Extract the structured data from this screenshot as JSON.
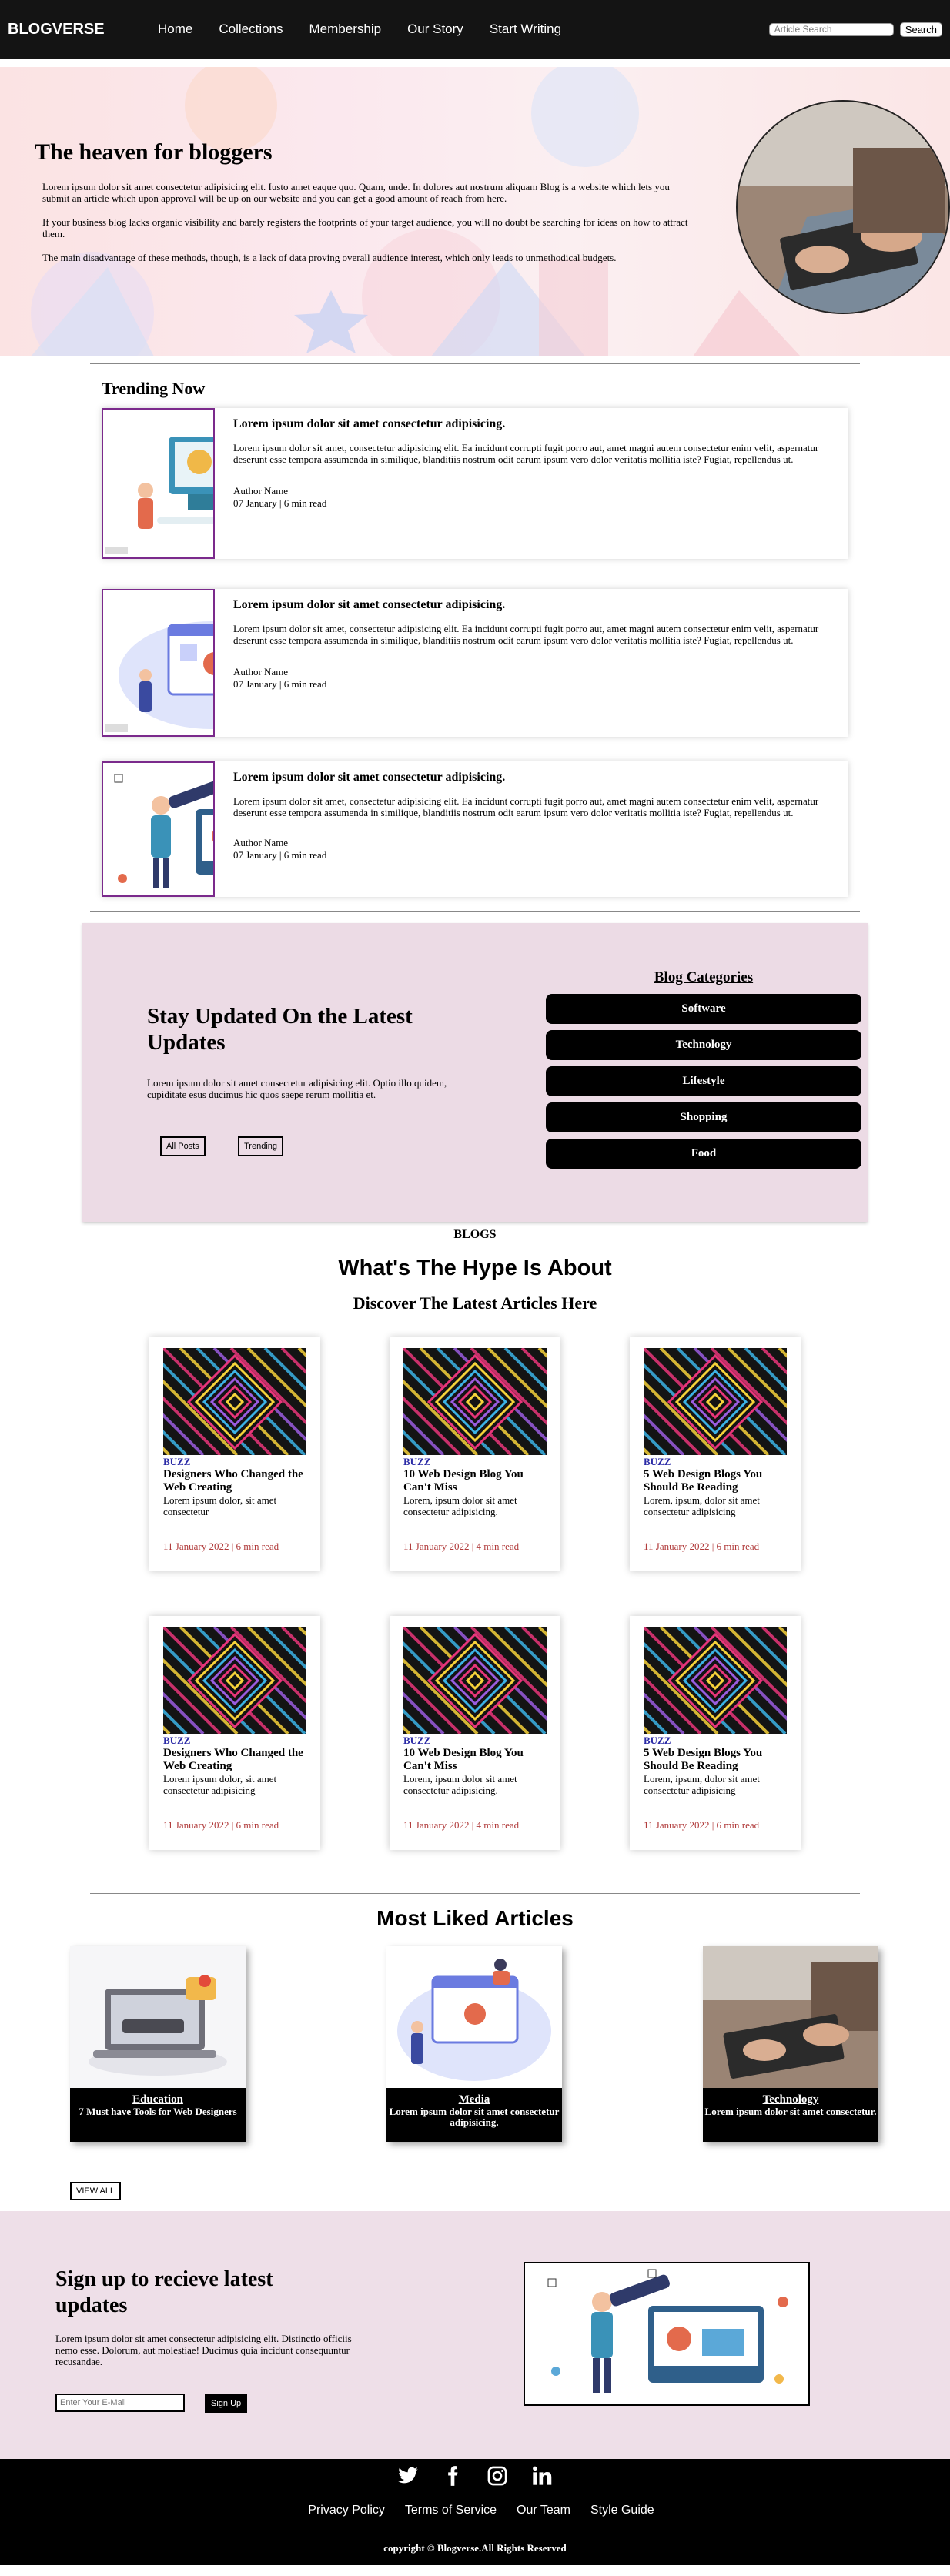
{
  "nav": {
    "brand": "BLOGVERSE",
    "links": [
      "Home",
      "Collections",
      "Membership",
      "Our Story",
      "Start Writing"
    ],
    "search_placeholder": "Article Search",
    "search_button": "Search"
  },
  "hero": {
    "title": "The heaven for bloggers",
    "paragraphs": [
      "Lorem ipsum dolor sit amet consectetur adipisicing elit. Iusto amet eaque quo. Quam, unde. In dolores aut nostrum aliquam Blog is a website which lets you submit an article which upon approval will be up on our website and you can get a good amount of reach from here.",
      "If your business blog lacks organic visibility and barely registers the footprints of your target audience, you will no doubt be searching for ideas on how to attract them.",
      "The main disadvantage of these methods, though, is a lack of data proving overall audience interest, which only leads to unmethodical budgets."
    ]
  },
  "trending": {
    "title": "Trending Now",
    "cards": [
      {
        "title": "Lorem ipsum dolor sit amet consectetur adipisicing.",
        "body": "Lorem ipsum dolor sit amet, consectetur adipisicing elit. Ea incidunt corrupti fugit porro aut, amet magni autem consectetur enim velit, aspernatur deserunt esse tempora assumenda in similique, blanditiis nostrum odit earum ipsum vero dolor veritatis mollitia iste? Fugiat, repellendus ut.",
        "author": "Author Name",
        "meta": "07 January | 6 min read"
      },
      {
        "title": "Lorem ipsum dolor sit amet consectetur adipisicing.",
        "body": "Lorem ipsum dolor sit amet, consectetur adipisicing elit. Ea incidunt corrupti fugit porro aut, amet magni autem consectetur enim velit, aspernatur deserunt esse tempora assumenda in similique, blanditiis nostrum odit earum ipsum vero dolor veritatis mollitia iste? Fugiat, repellendus ut.",
        "author": "Author Name",
        "meta": "07 January | 6 min read"
      },
      {
        "title": "Lorem ipsum dolor sit amet consectetur adipisicing.",
        "body": "Lorem ipsum dolor sit amet, consectetur adipisicing elit. Ea incidunt corrupti fugit porro aut, amet magni autem consectetur enim velit, aspernatur deserunt esse tempora assumenda in similique, blanditiis nostrum odit earum ipsum vero dolor veritatis mollitia iste? Fugiat, repellendus ut.",
        "author": "Author Name",
        "meta": "07 January | 6 min read"
      }
    ]
  },
  "updates": {
    "title": "Stay Updated On the Latest Updates",
    "body": "Lorem ipsum dolor sit amet consectetur adipisicing elit. Optio illo quidem, cupiditate esus ducimus hic quos saepe rerum mollitia et.",
    "btn_all": "All Posts",
    "btn_trending": "Trending",
    "categories_title": "Blog Categories",
    "categories": [
      "Software",
      "Technology",
      "Lifestyle",
      "Shopping",
      "Food"
    ]
  },
  "blogs": {
    "tag": "BLOGS",
    "title": "What's The Hype Is About",
    "subtitle": "Discover The Latest Articles Here",
    "cards": [
      {
        "label": "BUZZ",
        "title": "Designers Who Changed the Web Creating",
        "desc": "Lorem ipsum dolor, sit amet consectetur",
        "date": "11 January 2022 | 6 min read"
      },
      {
        "label": "BUZZ",
        "title": "10 Web Design Blog You Can't Miss",
        "desc": "Lorem, ipsum dolor sit amet consectetur adipisicing.",
        "date": "11 January 2022 | 4 min read"
      },
      {
        "label": "BUZZ",
        "title": "5 Web Design Blogs You Should Be Reading",
        "desc": "Lorem, ipsum, dolor sit amet consectetur adipisicing",
        "date": "11 January 2022 | 6 min read"
      },
      {
        "label": "BUZZ",
        "title": "Designers Who Changed the Web Creating",
        "desc": "Lorem ipsum dolor, sit amet consectetur adipisicing",
        "date": "11 January 2022 | 6 min read"
      },
      {
        "label": "BUZZ",
        "title": "10 Web Design Blog You Can't Miss",
        "desc": "Lorem, ipsum dolor sit amet consectetur adipisicing.",
        "date": "11 January 2022 | 4 min read"
      },
      {
        "label": "BUZZ",
        "title": "5 Web Design Blogs You Should Be Reading",
        "desc": "Lorem, ipsum, dolor sit amet consectetur adipisicing",
        "date": "11 January 2022 | 6 min read"
      }
    ]
  },
  "liked": {
    "title": "Most Liked Articles",
    "cards": [
      {
        "category": "Education",
        "text": "7 Must have Tools for Web Designers"
      },
      {
        "category": "Media",
        "text": "Lorem ipsum dolor sit amet consectetur adipisicing."
      },
      {
        "category": "Technology",
        "text": "Lorem ipsum dolor sit amet consectetur."
      }
    ],
    "view_all": "VIEW ALL"
  },
  "signup": {
    "title": "Sign up to recieve latest updates",
    "body": "Lorem ipsum dolor sit amet consectetur adipisicing elit. Distinctio officiis nemo esse. Dolorum, aut molestiae! Ducimus quia incidunt consequuntur recusandae.",
    "placeholder": "Enter Your E-Mail",
    "button": "Sign Up"
  },
  "footer": {
    "socials": [
      "twitter-icon",
      "facebook-icon",
      "instagram-icon",
      "linkedin-icon"
    ],
    "links": [
      "Privacy Policy",
      "Terms of Service",
      "Our Team",
      "Style Guide"
    ],
    "copyright": "copyright © Blogverse.All Rights Reserved"
  }
}
